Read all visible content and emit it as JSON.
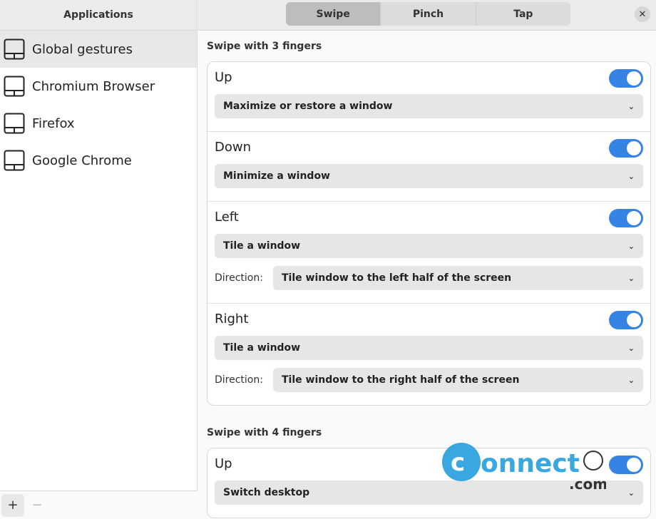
{
  "sidebar": {
    "title": "Applications",
    "items": [
      {
        "label": "Global gestures",
        "selected": true
      },
      {
        "label": "Chromium Browser"
      },
      {
        "label": "Firefox"
      },
      {
        "label": "Google Chrome"
      }
    ],
    "add": "+",
    "remove": "−",
    "icon": "touchpad-icon"
  },
  "tabs": [
    {
      "label": "Swipe",
      "active": true
    },
    {
      "label": "Pinch"
    },
    {
      "label": "Tap"
    }
  ],
  "close": "✕",
  "sections": [
    {
      "title": "Swipe with 3 fingers",
      "rows": [
        {
          "label": "Up",
          "enabled": true,
          "action": "Maximize or restore a window"
        },
        {
          "label": "Down",
          "enabled": true,
          "action": "Minimize a window"
        },
        {
          "label": "Left",
          "enabled": true,
          "action": "Tile a window",
          "direction_label": "Direction:",
          "direction": "Tile window to the left half of the screen"
        },
        {
          "label": "Right",
          "enabled": true,
          "action": "Tile a window",
          "direction_label": "Direction:",
          "direction": "Tile window to the right half of the screen"
        }
      ]
    },
    {
      "title": "Swipe with 4 fingers",
      "rows": [
        {
          "label": "Up",
          "enabled": true,
          "action": "Switch desktop"
        }
      ]
    }
  ],
  "watermark": {
    "text": "connect",
    "suffix": ".com"
  },
  "colors": {
    "accent": "#3584e4",
    "watermark": "#3aa8e0"
  }
}
